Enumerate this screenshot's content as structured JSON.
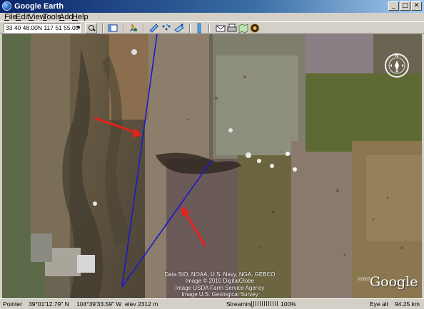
{
  "window": {
    "title": "Google Earth"
  },
  "menu": {
    "file": "File",
    "edit": "Edit",
    "view": "View",
    "tools": "Tools",
    "add": "Add",
    "help": "Help",
    "file_key": "F",
    "edit_key": "E",
    "view_key": "V",
    "tools_key": "T",
    "add_key": "A",
    "help_key": "H"
  },
  "toolbar": {
    "search_value": "33 40 48.00N 117 51 55.00W",
    "icons": [
      "sidebar-toggle-icon",
      "placemark-icon",
      "polygon-icon",
      "path-icon",
      "image-overlay-icon",
      "ruler-icon",
      "email-icon",
      "print-icon",
      "google-maps-icon",
      "sky-icon"
    ]
  },
  "map": {
    "attribution": [
      "Data SIO, NOAA, U.S. Navy, NGA, GEBCO",
      "Image © 2010 DigitalGlobe",
      "Image USDA Farm Service Agency",
      "Image U.S. Geological Survey"
    ],
    "copyright_year": "©2007",
    "logo": "Google",
    "compass_letter": "N",
    "line_color": "#1a1acc",
    "arrow_color": "#e8201c"
  },
  "status": {
    "pointer_label": "Pointer",
    "lat": "39°01'12.79\" N",
    "lon": "104°39'33.59\" W",
    "elev": "elev 2312 m",
    "streaming_label": "Streaming",
    "streaming_pct": "100%",
    "streaming_fraction": 1.0,
    "eye_alt_label": "Eye alt",
    "eye_alt": "94.25 km"
  }
}
